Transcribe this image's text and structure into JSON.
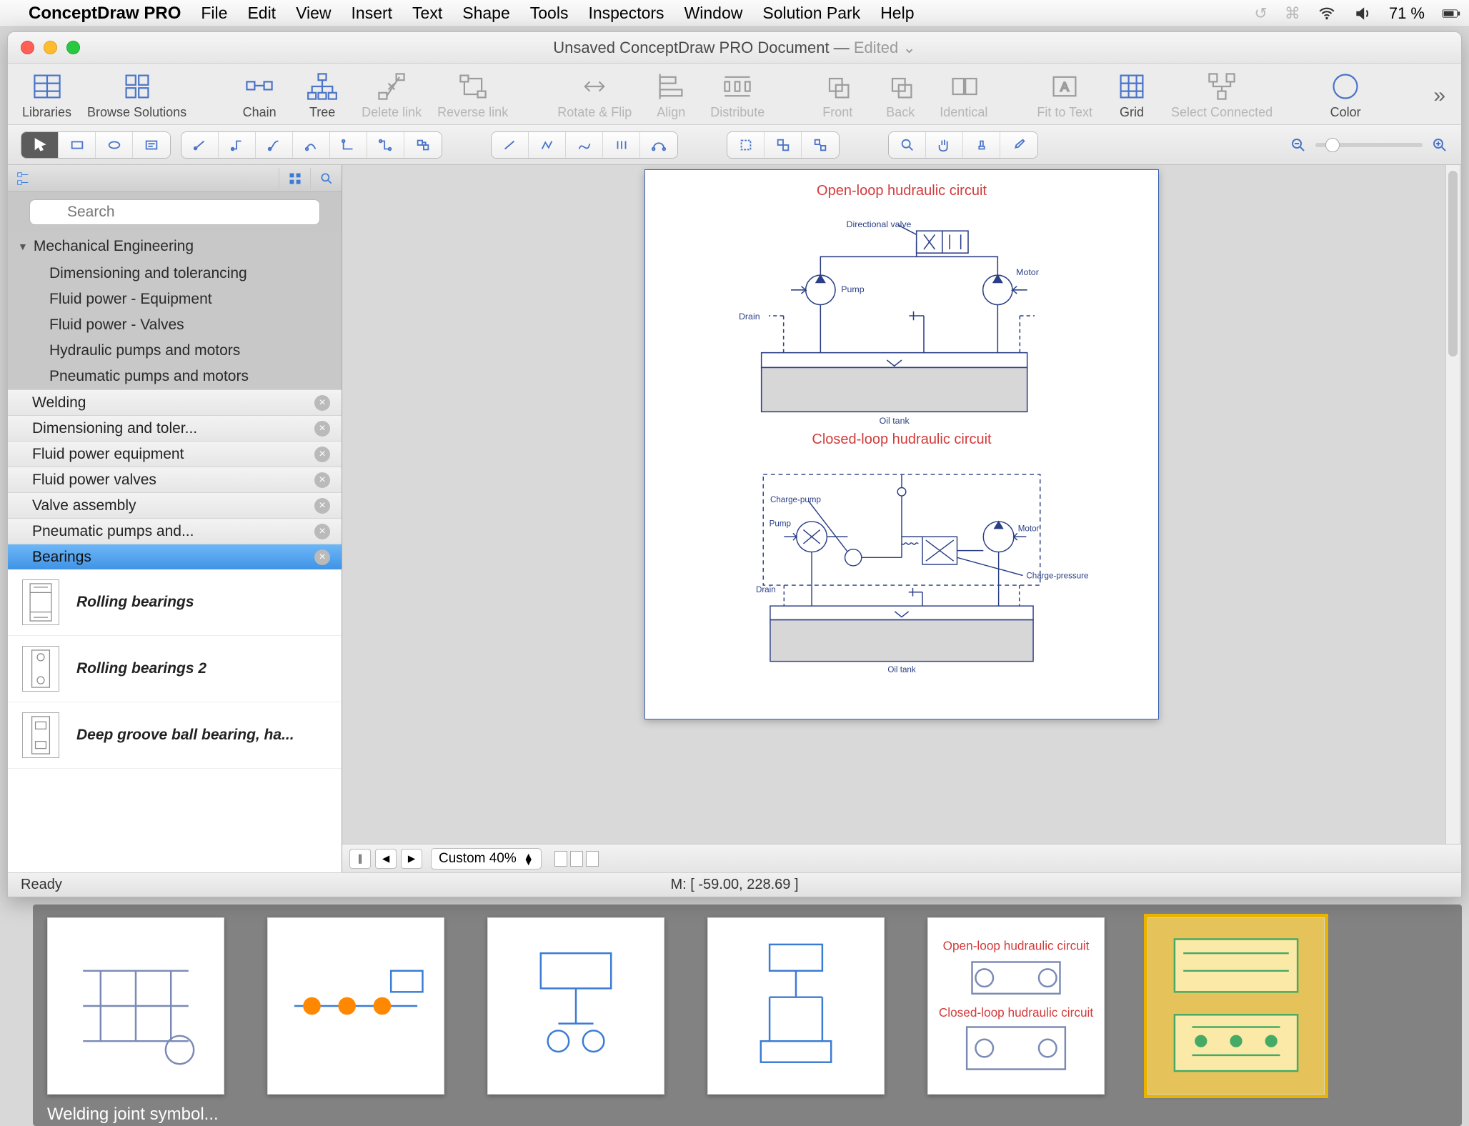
{
  "menubar": {
    "app": "ConceptDraw PRO",
    "items": [
      "File",
      "Edit",
      "View",
      "Insert",
      "Text",
      "Shape",
      "Tools",
      "Inspectors",
      "Window",
      "Solution Park",
      "Help"
    ],
    "battery": "71 %"
  },
  "window": {
    "title": "Unsaved ConceptDraw PRO Document — ",
    "edited": "Edited",
    "chevron": "⌄"
  },
  "toolbar": {
    "libraries": "Libraries",
    "browse_solutions": "Browse Solutions",
    "chain": "Chain",
    "tree": "Tree",
    "delete_link": "Delete link",
    "reverse_link": "Reverse link",
    "rotate_flip": "Rotate & Flip",
    "align": "Align",
    "distribute": "Distribute",
    "front": "Front",
    "back": "Back",
    "identical": "Identical",
    "fit_to_text": "Fit to Text",
    "grid": "Grid",
    "select_connected": "Select Connected",
    "color": "Color"
  },
  "sidebar": {
    "search_placeholder": "Search",
    "tree_title": "Mechanical Engineering",
    "tree_items": [
      "Dimensioning and tolerancing",
      "Fluid power - Equipment",
      "Fluid power - Valves",
      "Hydraulic pumps and motors",
      "Pneumatic pumps and motors"
    ],
    "libs": [
      "Welding",
      "Dimensioning and toler...",
      "Fluid power equipment",
      "Fluid power valves",
      "Valve assembly",
      "Pneumatic pumps and...",
      "Bearings"
    ],
    "stencils": [
      "Rolling bearings",
      "Rolling bearings 2",
      "Deep groove ball bearing, ha..."
    ]
  },
  "canvas": {
    "diagram1_title": "Open-loop hudraulic circuit",
    "diagram2_title": "Closed-loop hudraulic circuit",
    "labels": {
      "directional_valve": "Directional valve",
      "pump": "Pump",
      "motor": "Motor",
      "drain": "Drain",
      "oil_tank": "Oil tank",
      "charge_pump": "Charge-pump",
      "charge_pressure": "Charge-pressure"
    },
    "zoom_label": "Custom 40%"
  },
  "status": {
    "ready": "Ready",
    "mouse": "M: [ -59.00, 228.69 ]"
  },
  "gallery": {
    "caption": "Welding joint symbol..."
  }
}
